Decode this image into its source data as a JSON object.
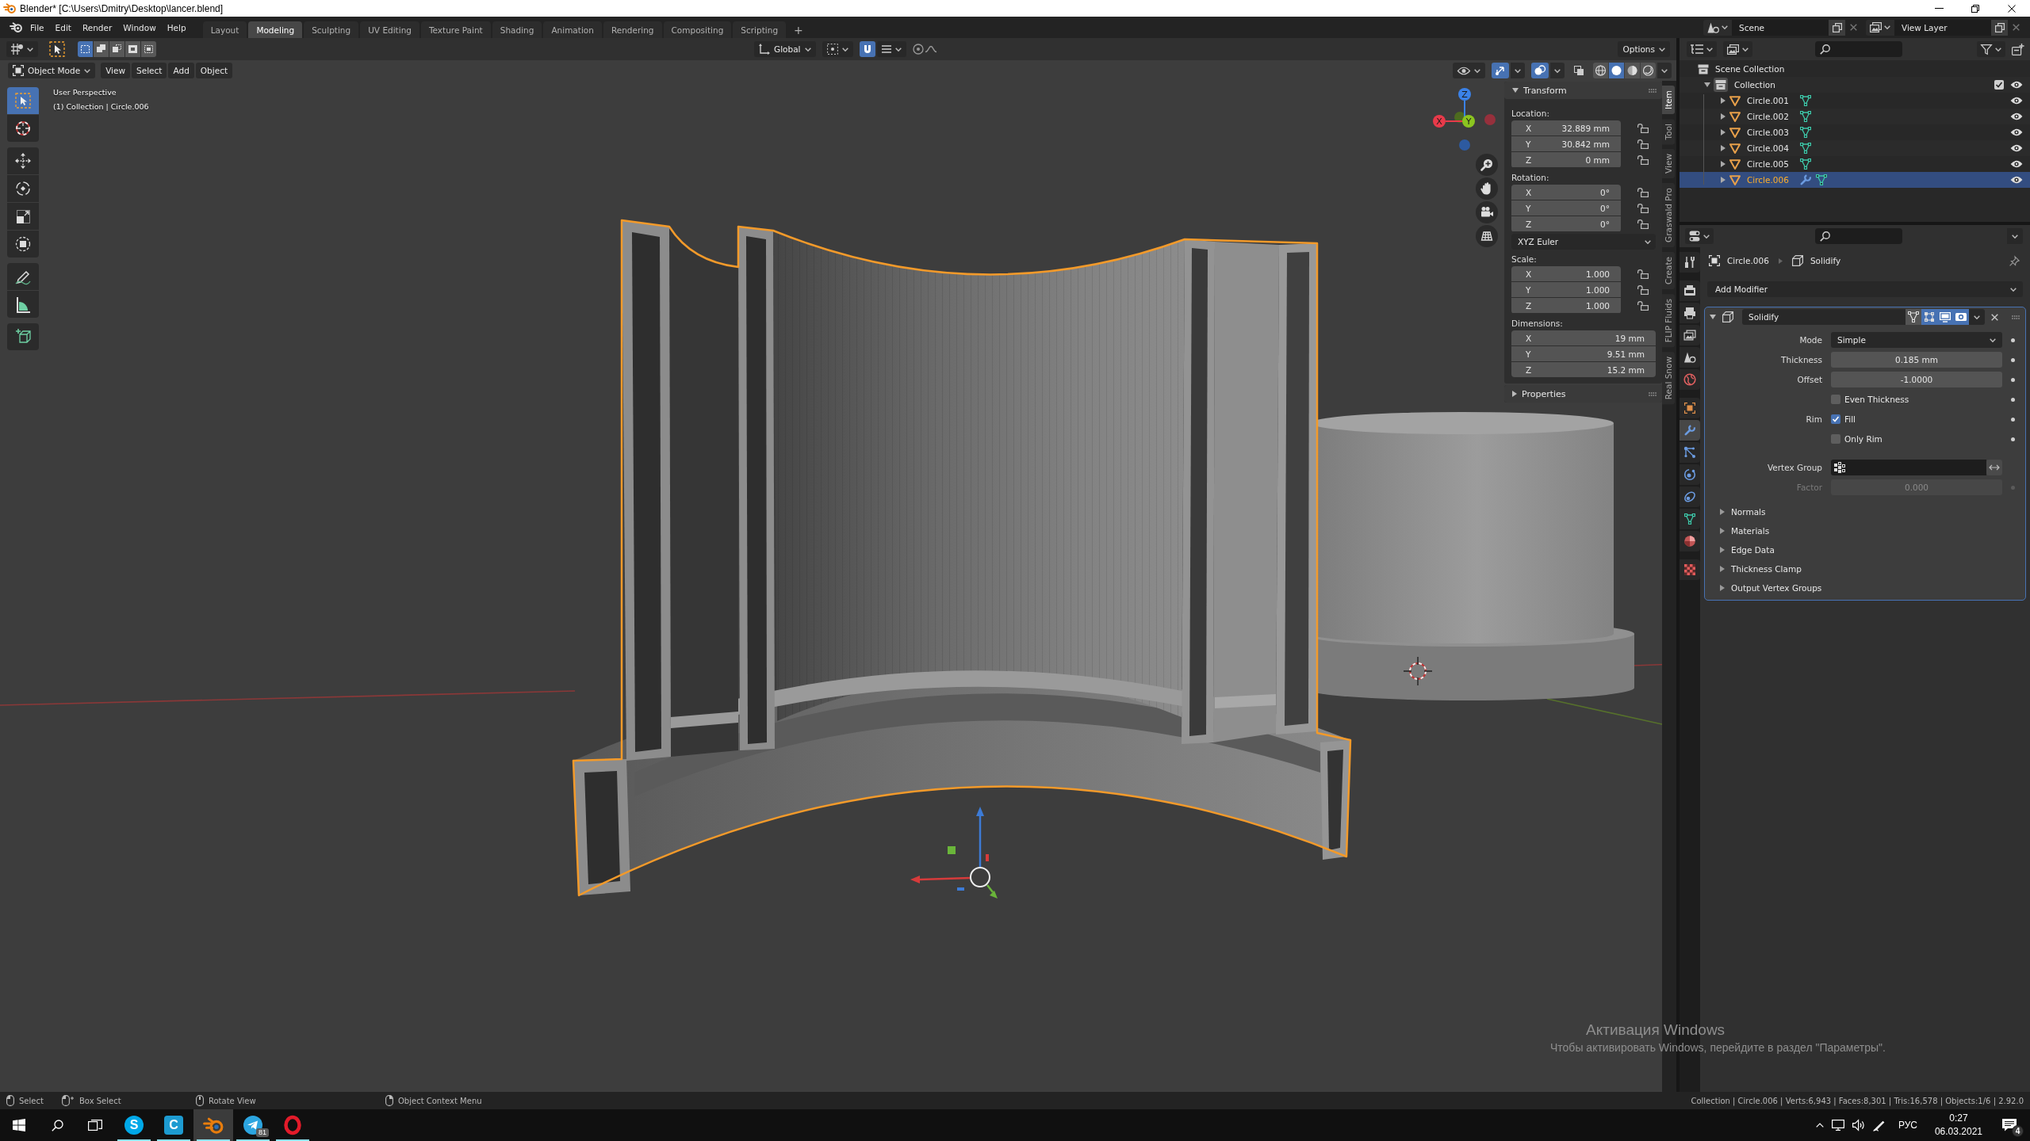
{
  "title_bar": {
    "title": "Blender* [C:\\Users\\Dmitry\\Desktop\\lancer.blend]"
  },
  "top_bar": {
    "menus": [
      "File",
      "Edit",
      "Render",
      "Window",
      "Help"
    ],
    "workspaces": [
      {
        "label": "Layout",
        "selected": false
      },
      {
        "label": "Modeling",
        "selected": true
      },
      {
        "label": "Sculpting",
        "selected": false
      },
      {
        "label": "UV Editing",
        "selected": false
      },
      {
        "label": "Texture Paint",
        "selected": false
      },
      {
        "label": "Shading",
        "selected": false
      },
      {
        "label": "Animation",
        "selected": false
      },
      {
        "label": "Rendering",
        "selected": false
      },
      {
        "label": "Compositing",
        "selected": false
      },
      {
        "label": "Scripting",
        "selected": false
      }
    ],
    "add_workspace": "+",
    "scene": "Scene",
    "view_layer": "View Layer"
  },
  "tool_header": {
    "select_modes": [
      {
        "selected": true
      },
      {
        "selected": false
      },
      {
        "selected": false
      },
      {
        "selected": false
      },
      {
        "selected": false
      }
    ],
    "orientation": "Global",
    "snap": {
      "on": true
    },
    "options": "Options"
  },
  "viewport_header": {
    "mode": "Object Mode",
    "menus": [
      "View",
      "Select",
      "Add",
      "Object"
    ],
    "gizmos": {
      "on": true
    },
    "overlays": {
      "on": true
    },
    "xray": {
      "on": false
    },
    "shading": [
      {
        "kind": "wireframe",
        "selected": false
      },
      {
        "kind": "solid",
        "selected": true
      },
      {
        "kind": "material",
        "selected": false
      },
      {
        "kind": "rendered",
        "selected": false
      }
    ]
  },
  "viewport": {
    "info": [
      "User Perspective",
      "(1) Collection | Circle.006"
    ],
    "tool_groups": [
      [
        {
          "kind": "select_box",
          "selected": true
        },
        {
          "kind": "cursor",
          "selected": false
        }
      ],
      [
        {
          "kind": "move",
          "selected": false
        },
        {
          "kind": "rotate",
          "selected": false
        },
        {
          "kind": "scale",
          "selected": false
        },
        {
          "kind": "transform",
          "selected": false
        }
      ],
      [
        {
          "kind": "annotate",
          "selected": false
        },
        {
          "kind": "measure",
          "selected": false
        }
      ],
      [
        {
          "kind": "add_cube",
          "selected": false
        }
      ]
    ],
    "gizmo_axes": {
      "x": "X",
      "y": "Y",
      "z": "Z"
    }
  },
  "sidebar": {
    "tabs": [
      {
        "label": "Item",
        "selected": true
      },
      {
        "label": "Tool",
        "selected": false
      },
      {
        "label": "View",
        "selected": false
      },
      {
        "label": "Graswald Pro",
        "selected": false
      },
      {
        "label": "Create",
        "selected": false
      },
      {
        "label": "FLIP Fluids",
        "selected": false
      },
      {
        "label": "Real Snow",
        "selected": false
      }
    ],
    "transform": {
      "title": "Transform",
      "expanded": true,
      "groups": [
        {
          "label": "Location:",
          "fields": [
            {
              "axis": "X",
              "value": "32.889 mm",
              "locked": false
            },
            {
              "axis": "Y",
              "value": "30.842 mm",
              "locked": false
            },
            {
              "axis": "Z",
              "value": "0 mm",
              "locked": false
            }
          ]
        },
        {
          "label": "Rotation:",
          "fields": [
            {
              "axis": "X",
              "value": "0°",
              "locked": false
            },
            {
              "axis": "Y",
              "value": "0°",
              "locked": false
            },
            {
              "axis": "Z",
              "value": "0°",
              "locked": false
            }
          ],
          "mode": "XYZ Euler"
        },
        {
          "label": "Scale:",
          "fields": [
            {
              "axis": "X",
              "value": "1.000",
              "locked": false
            },
            {
              "axis": "Y",
              "value": "1.000",
              "locked": false
            },
            {
              "axis": "Z",
              "value": "1.000",
              "locked": false
            }
          ]
        },
        {
          "label": "Dimensions:",
          "fields": [
            {
              "axis": "X",
              "value": "19 mm"
            },
            {
              "axis": "Y",
              "value": "9.51 mm"
            },
            {
              "axis": "Z",
              "value": "15.2 mm"
            }
          ]
        }
      ]
    },
    "properties_panel": {
      "title": "Properties",
      "expanded": false
    }
  },
  "outliner": {
    "items": [
      {
        "kind": "scene_collection",
        "label": "Scene Collection",
        "children": [
          {
            "kind": "collection",
            "label": "Collection",
            "expanded": true,
            "checked": true,
            "visible": true,
            "children": [
              {
                "kind": "object",
                "label": "Circle.001",
                "expanded": false,
                "selected": false,
                "has_modifier": false,
                "visible": true
              },
              {
                "kind": "object",
                "label": "Circle.002",
                "expanded": false,
                "selected": false,
                "has_modifier": false,
                "visible": true
              },
              {
                "kind": "object",
                "label": "Circle.003",
                "expanded": false,
                "selected": false,
                "has_modifier": false,
                "visible": true
              },
              {
                "kind": "object",
                "label": "Circle.004",
                "expanded": false,
                "selected": false,
                "has_modifier": false,
                "visible": true
              },
              {
                "kind": "object",
                "label": "Circle.005",
                "expanded": false,
                "selected": false,
                "has_modifier": false,
                "visible": true
              },
              {
                "kind": "object",
                "label": "Circle.006",
                "expanded": false,
                "selected": true,
                "has_modifier": true,
                "visible": true
              }
            ]
          }
        ]
      }
    ]
  },
  "properties_editor": {
    "tab_groups": [
      [
        {
          "kind": "tool",
          "selected": false
        }
      ],
      [
        {
          "kind": "render",
          "selected": false
        },
        {
          "kind": "output",
          "selected": false
        },
        {
          "kind": "view_layer",
          "selected": false
        },
        {
          "kind": "scene",
          "selected": false
        },
        {
          "kind": "world",
          "selected": false
        }
      ],
      [
        {
          "kind": "object",
          "selected": false
        },
        {
          "kind": "modifiers",
          "selected": true
        },
        {
          "kind": "particles",
          "selected": false
        },
        {
          "kind": "physics",
          "selected": false
        },
        {
          "kind": "constraints",
          "selected": false
        },
        {
          "kind": "data",
          "selected": false
        },
        {
          "kind": "material",
          "selected": false
        }
      ],
      [
        {
          "kind": "texture",
          "selected": false
        }
      ]
    ],
    "breadcrumb": {
      "object": "Circle.006",
      "modifier": "Solidify"
    },
    "add_modifier": "Add Modifier",
    "modifier": {
      "name": "Solidify",
      "expanded": true,
      "toggles": [
        {
          "kind": "on_cage",
          "on": false
        },
        {
          "kind": "edit_mode",
          "on": true
        },
        {
          "kind": "viewport",
          "on": true
        },
        {
          "kind": "render",
          "on": true
        }
      ],
      "rows": [
        {
          "kind": "dropdown",
          "label": "Mode",
          "value": "Simple",
          "disabled": false
        },
        {
          "kind": "number",
          "label": "Thickness",
          "value": "0.185 mm",
          "disabled": false
        },
        {
          "kind": "number",
          "label": "Offset",
          "value": "-1.0000",
          "disabled": false
        },
        {
          "kind": "checkbox",
          "option": "Even Thickness",
          "checked": false,
          "disabled": false
        },
        {
          "kind": "checkbox",
          "label": "Rim",
          "option": "Fill",
          "checked": true,
          "disabled": false
        },
        {
          "kind": "checkbox",
          "option": "Only Rim",
          "checked": false,
          "disabled": false
        },
        {
          "kind": "vertex_group",
          "label": "Vertex Group",
          "inverted": false,
          "disabled": false
        },
        {
          "kind": "number",
          "label": "Factor",
          "value": "0.000",
          "disabled": true
        }
      ],
      "subpanels": [
        {
          "label": "Normals",
          "expanded": false
        },
        {
          "label": "Materials",
          "expanded": false
        },
        {
          "label": "Edge Data",
          "expanded": false
        },
        {
          "label": "Thickness Clamp",
          "expanded": false
        },
        {
          "label": "Output Vertex Groups",
          "expanded": false
        }
      ]
    }
  },
  "status_bar": {
    "hints": [
      {
        "kind": "left_click",
        "label": "Select"
      },
      {
        "kind": "left_drag",
        "label": "Box Select"
      },
      {
        "kind": "middle_drag",
        "label": "Rotate View"
      },
      {
        "kind": "right_click",
        "label": "Object Context Menu"
      }
    ],
    "stats": "Collection | Circle.006 | Verts:6,943 | Faces:8,301 | Tris:16,578 | Objects:1/6 | 2.92.0"
  },
  "taskbar": {
    "apps": [
      {
        "kind": "letter_disc",
        "glyph": "S",
        "selected": false,
        "running": true
      },
      {
        "kind": "letter_tile",
        "glyph": "C",
        "selected": false,
        "running": true
      },
      {
        "kind": "orbit_logo",
        "selected": true,
        "running": true
      },
      {
        "kind": "paper_plane",
        "badge": "81",
        "selected": false,
        "running": true
      },
      {
        "kind": "ring",
        "selected": false,
        "running": true
      }
    ],
    "language": "РУС",
    "time": "0:27",
    "date": "06.03.2021",
    "notification_count": "4"
  },
  "activation_notice": {
    "title": "Активация Windows",
    "text": "Чтобы активировать Windows, перейдите в раздел \"Параметры\"."
  }
}
